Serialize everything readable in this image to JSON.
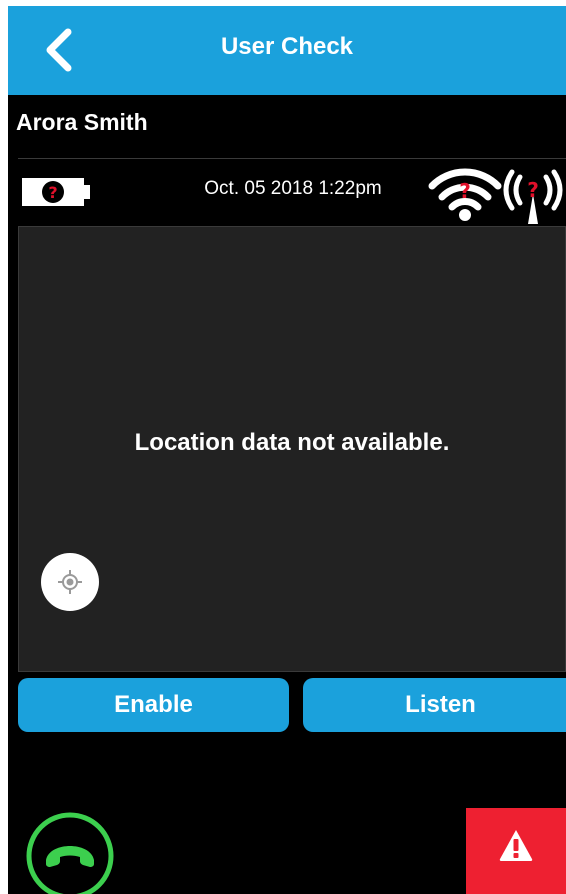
{
  "header": {
    "title": "User Check",
    "back_icon": "chevron-left-icon"
  },
  "user": {
    "name": "Arora Smith"
  },
  "status_bar": {
    "battery_icon": "battery-unknown-icon",
    "timestamp": "Oct. 05 2018 1:22pm",
    "wifi_icon": "wifi-unknown-icon",
    "signal_icon": "cellular-signal-unknown-icon"
  },
  "map": {
    "message": "Location data not available.",
    "locate_icon": "locate-crosshair-icon"
  },
  "actions": {
    "enable_label": "Enable",
    "listen_label": "Listen"
  },
  "footer": {
    "hangup_icon": "phone-hangup-icon",
    "alert_icon": "warning-triangle-icon"
  },
  "colors": {
    "accent": "#1ba1dc",
    "background": "#000000",
    "map_background": "#222222",
    "hangup_green": "#3ccf4e",
    "alert_red": "#ee2031",
    "unknown_status_red": "#e0102a"
  }
}
